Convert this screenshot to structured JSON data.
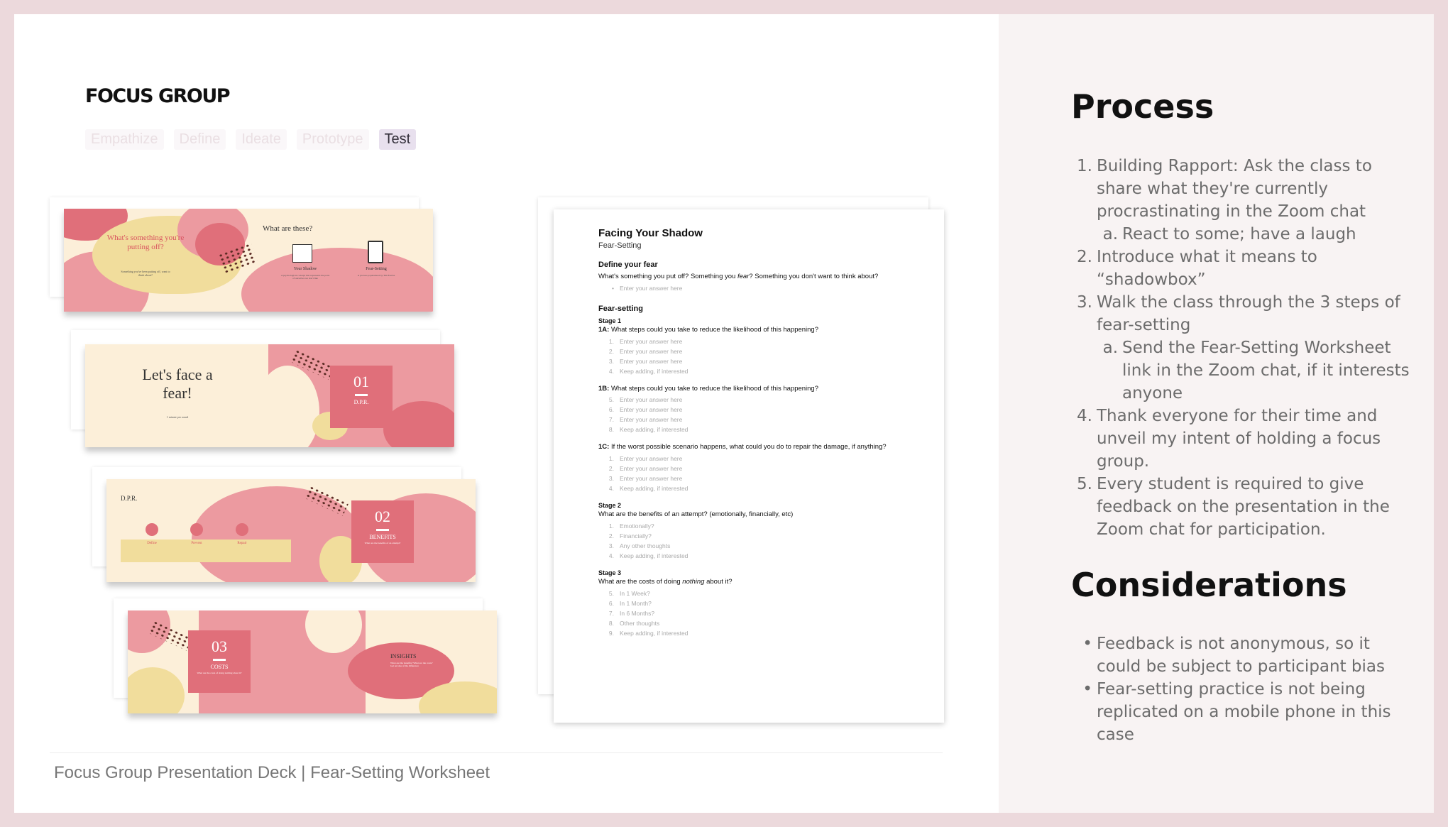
{
  "header": {
    "title": "FOCUS GROUP",
    "stages": [
      {
        "label": "Empathize",
        "active": false
      },
      {
        "label": "Define",
        "active": false
      },
      {
        "label": "Ideate",
        "active": false
      },
      {
        "label": "Prototype",
        "active": false
      },
      {
        "label": "Test",
        "active": true
      }
    ]
  },
  "deck": {
    "slide1": {
      "question": "What's something you're putting off?",
      "question_note": "Something you've been putting off, want to think about?",
      "what_title": "What are these?",
      "item1": "Your Shadow",
      "item1_note": "A psychological concept that represents the parts of ourselves we don't like",
      "item2": "Fear-Setting",
      "item2_note": "A process popularized by Tim Ferriss"
    },
    "slide2": {
      "title": "Let's face a fear!",
      "note": "1 minute per round",
      "num": "01",
      "cap": "D.P.R."
    },
    "slide3": {
      "label": "D.P.R.",
      "col1": "Define",
      "col2": "Prevent",
      "col3": "Repair",
      "num": "02",
      "cap": "BENEFITS",
      "cap_note": "What are the benefits of an attempt?"
    },
    "slide4": {
      "num": "03",
      "cap": "COSTS",
      "cap_note": "What are the costs of doing nothing about it?",
      "insights": "INSIGHTS",
      "insights_note": "What are the benefits? What are the costs? Get an idea of the difference"
    }
  },
  "worksheet": {
    "title": "Facing Your Shadow",
    "subtitle": "Fear-Setting",
    "define_heading": "Define your fear",
    "define_question_a": "What's something you put off? Something you ",
    "define_question_em": "fear",
    "define_question_b": "? Something you don't want to think about?",
    "define_placeholder": "Enter your answer here",
    "fear_heading": "Fear-setting",
    "stage1": "Stage 1",
    "q1a_label": "1A:",
    "q1a": " What steps could you take to reduce the likelihood of this happening?",
    "list1a": [
      {
        "n": "1.",
        "t": "Enter your answer here"
      },
      {
        "n": "2.",
        "t": "Enter your answer here"
      },
      {
        "n": "3.",
        "t": "Enter your answer here"
      },
      {
        "n": "4.",
        "t": "Keep adding, if interested"
      }
    ],
    "q1b_label": "1B:",
    "q1b": " What steps could you take to reduce the likelihood of this happening?",
    "list1b": [
      {
        "n": "5.",
        "t": "Enter your answer here"
      },
      {
        "n": "6.",
        "t": "Enter your answer here"
      },
      {
        "n": "7.",
        "t": "Enter your answer here"
      },
      {
        "n": "8.",
        "t": "Keep adding, if interested"
      }
    ],
    "q1c_label": "1C:",
    "q1c": " If the worst possible scenario happens, what could you do to repair the damage, if anything?",
    "list1c": [
      {
        "n": "1.",
        "t": "Enter your answer here"
      },
      {
        "n": "2.",
        "t": "Enter your answer here"
      },
      {
        "n": "3.",
        "t": "Enter your answer here"
      },
      {
        "n": "4.",
        "t": "Keep adding, if interested"
      }
    ],
    "stage2": "Stage 2",
    "q2": "What are the benefits of an attempt? (emotionally, financially, etc)",
    "list2": [
      {
        "n": "1.",
        "t": "Emotionally?"
      },
      {
        "n": "2.",
        "t": "Financially?"
      },
      {
        "n": "3.",
        "t": "Any other thoughts"
      },
      {
        "n": "4.",
        "t": "Keep adding, if interested"
      }
    ],
    "stage3": "Stage 3",
    "q3a": "What are the costs of doing ",
    "q3em": "nothing",
    "q3b": " about it?",
    "list3": [
      {
        "n": "5.",
        "t": "In 1 Week?"
      },
      {
        "n": "6.",
        "t": "In 1 Month?"
      },
      {
        "n": "7.",
        "t": "In 6 Months?"
      },
      {
        "n": "8.",
        "t": "Other thoughts"
      },
      {
        "n": "9.",
        "t": "Keep adding, if interested"
      }
    ]
  },
  "caption": "Focus Group Presentation Deck | Fear-Setting Worksheet",
  "process": {
    "heading": "Process",
    "items": [
      {
        "mk": "1.",
        "text": "Building Rapport: Ask the class to share what they're currently procrastinating in the Zoom chat",
        "sub": false
      },
      {
        "mk": "a.",
        "text": "React to some; have a laugh",
        "sub": true
      },
      {
        "mk": "2.",
        "text": "Introduce what it means to “shadowbox”",
        "sub": false
      },
      {
        "mk": "3.",
        "text": "Walk the class through the 3 steps of fear-setting",
        "sub": false
      },
      {
        "mk": "a.",
        "text": "Send the Fear-Setting Worksheet link in the Zoom chat, if it interests anyone",
        "sub": true
      },
      {
        "mk": "4.",
        "text": "Thank everyone for their time and unveil my intent of holding a focus group.",
        "sub": false
      },
      {
        "mk": "5.",
        "text": "Every student is required to give feedback on the presentation in the Zoom chat for participation.",
        "sub": false
      }
    ]
  },
  "considerations": {
    "heading": "Considerations",
    "items": [
      {
        "mk": "•",
        "text": "Feedback is not anonymous, so it could be subject to participant bias"
      },
      {
        "mk": "•",
        "text": "Fear-setting practice is not being replicated on a mobile phone in this case"
      }
    ]
  },
  "colors": {
    "frame": "#ecd9dc",
    "panel": "#f8f3f3",
    "coral": "#e06f7a",
    "pink": "#ec9aa0",
    "cream": "#fcefd9",
    "sand": "#f1dd9c",
    "active_pill": "#e8e0ee"
  }
}
